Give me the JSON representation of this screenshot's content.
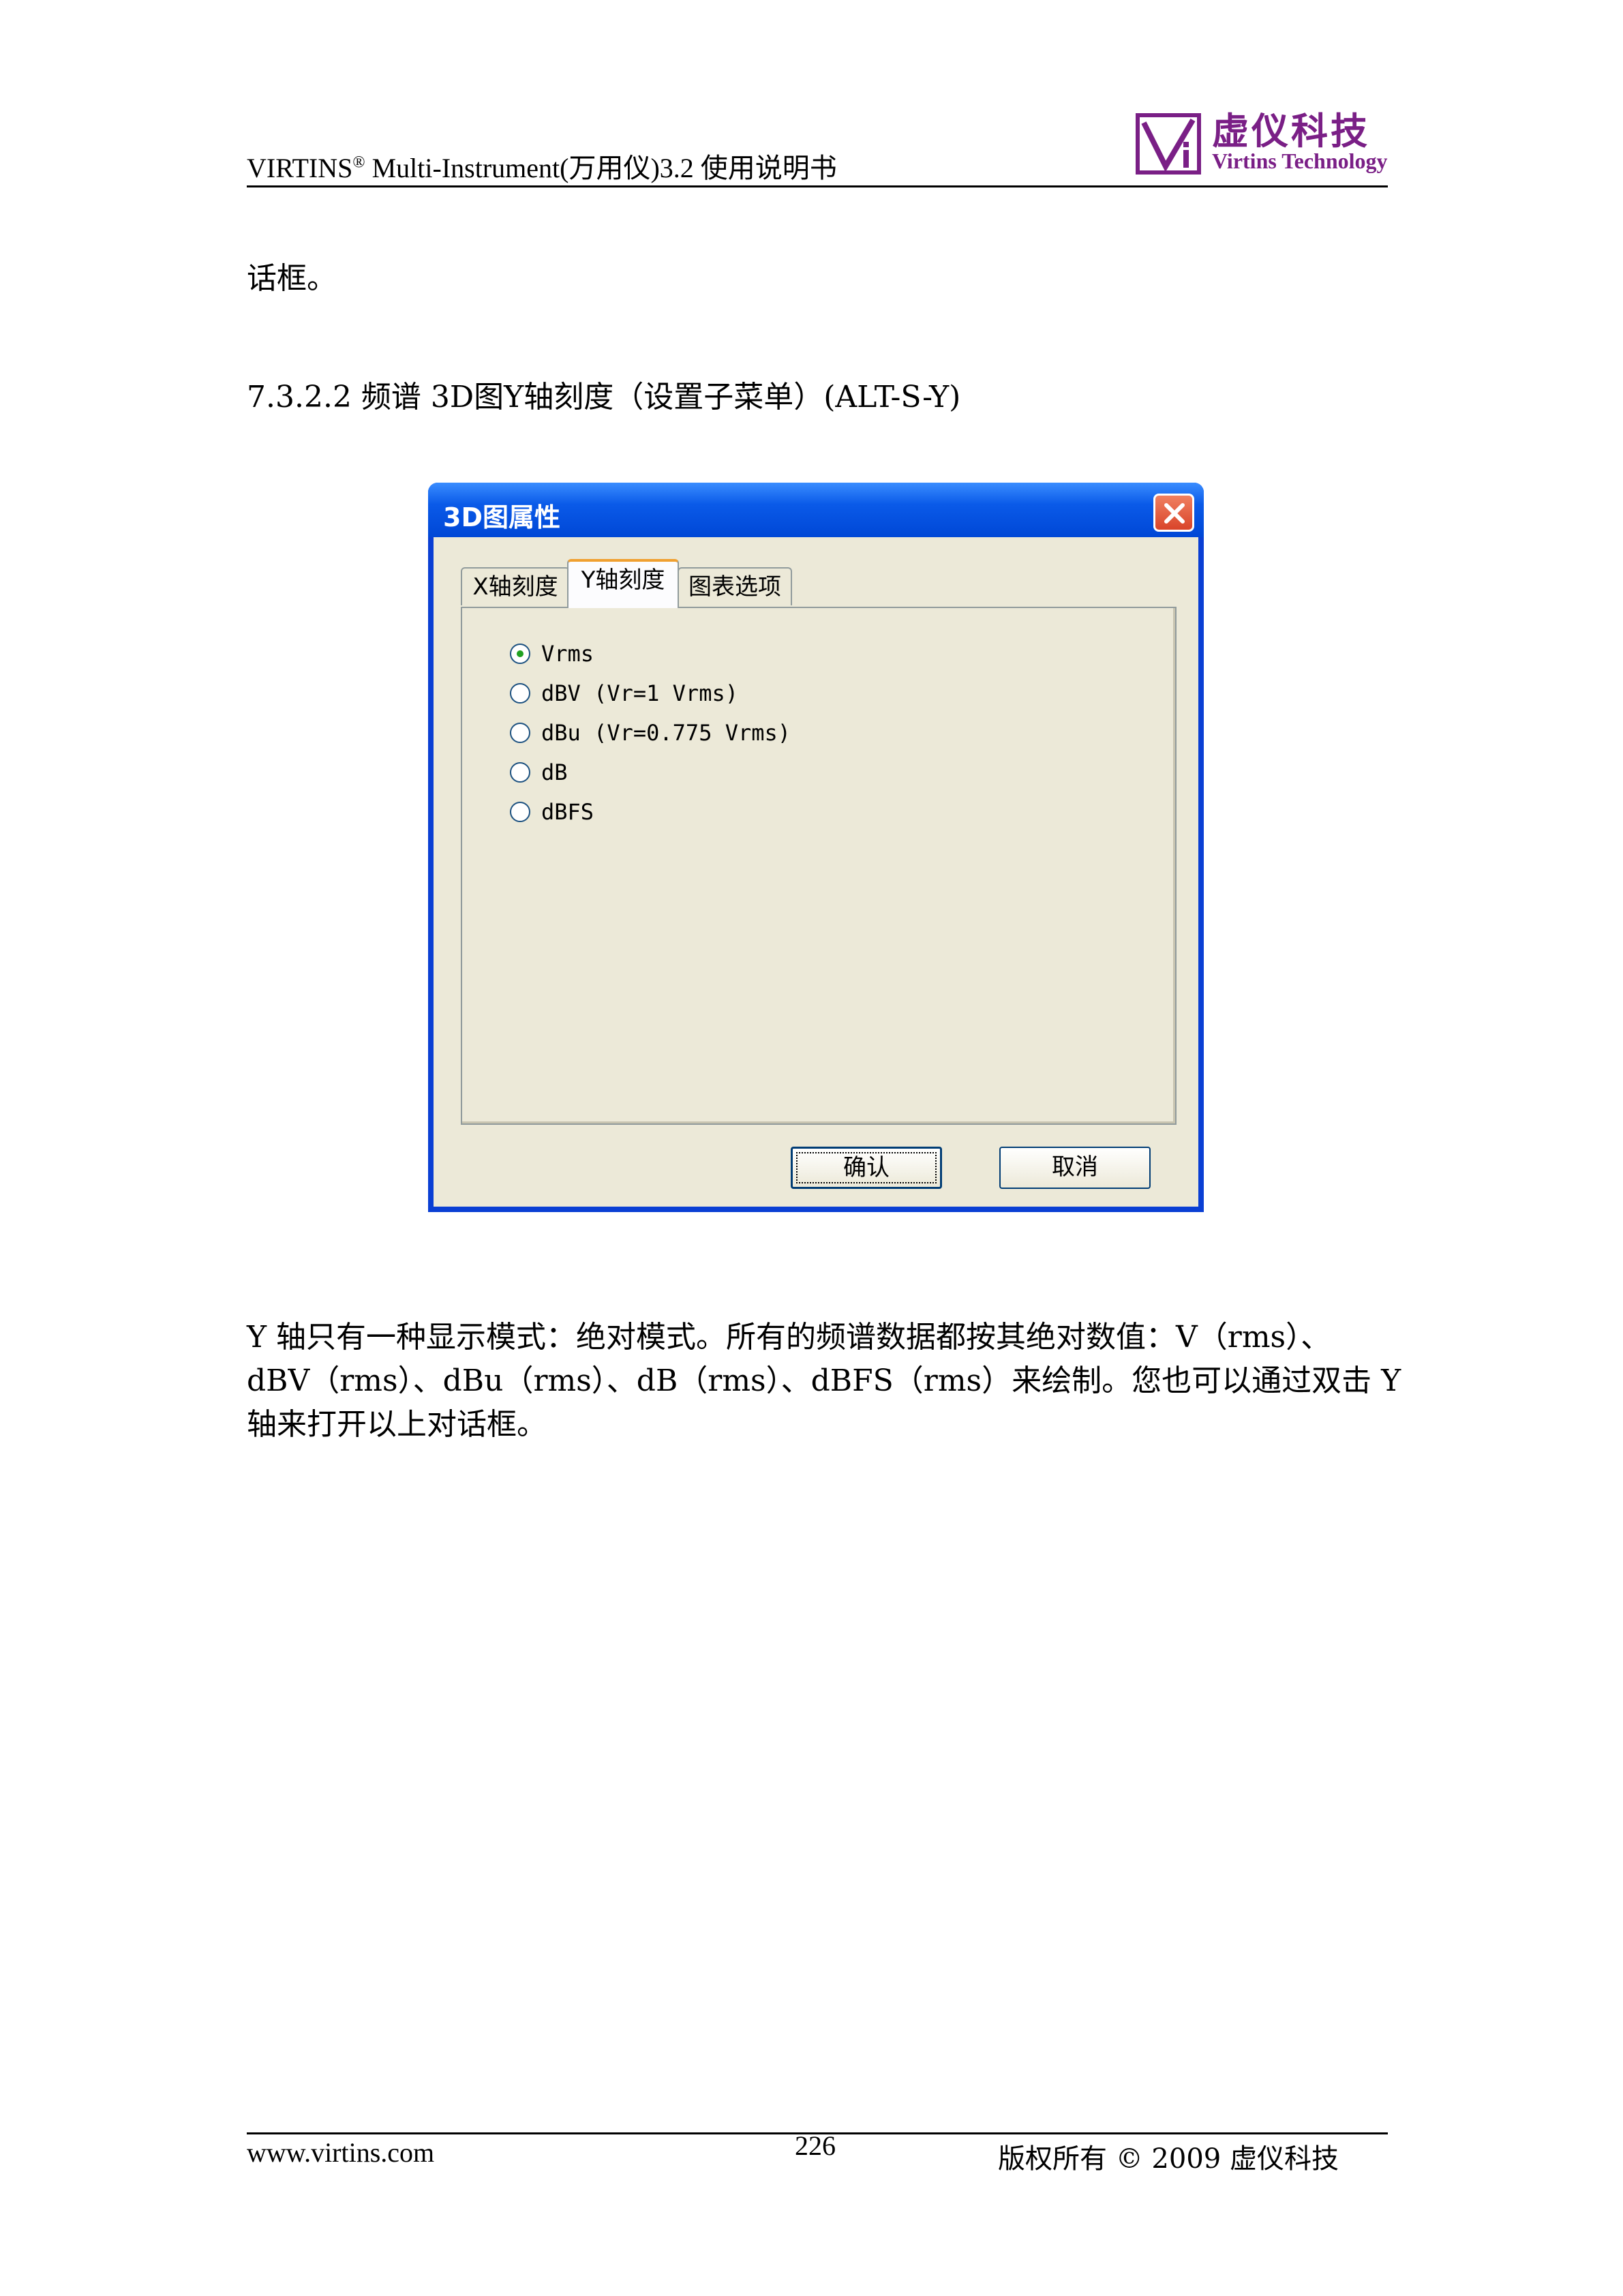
{
  "header": {
    "title_prefix": "VIRTINS",
    "registered": "®",
    "title_rest": " Multi-Instrument(万用仪)3.2 使用说明书",
    "logo_cn": "虚仪科技",
    "logo_en": "Virtins Technology",
    "logo_color": "#7a1f86"
  },
  "body": {
    "intro_fragment": "话框。",
    "section_heading": "7.3.2.2 频谱 3D图Y轴刻度（设置子菜单）(ALT-S-Y)",
    "paragraph_lines": [
      "Y 轴只有一种显示模式：绝对模式。所有的频谱数据都按其绝对数值：V（rms）、",
      "dBV（rms）、dBu（rms）、dB（rms）、dBFS（rms）来绘制。您也可以通过双击 Y",
      "轴来打开以上对话框。"
    ]
  },
  "dialog": {
    "title": "3D图属性",
    "tabs": [
      "X轴刻度",
      "Y轴刻度",
      "图表选项"
    ],
    "active_tab": 1,
    "options": [
      "Vrms",
      "dBV (Vr=1 Vrms)",
      "dBu (Vr=0.775 Vrms)",
      "dB",
      "dBFS"
    ],
    "selected_option": 0,
    "ok_label": "确认",
    "cancel_label": "取消"
  },
  "footer": {
    "website": "www.virtins.com",
    "page_number": "226",
    "copyright": "版权所有 © 2009 虚仪科技"
  }
}
